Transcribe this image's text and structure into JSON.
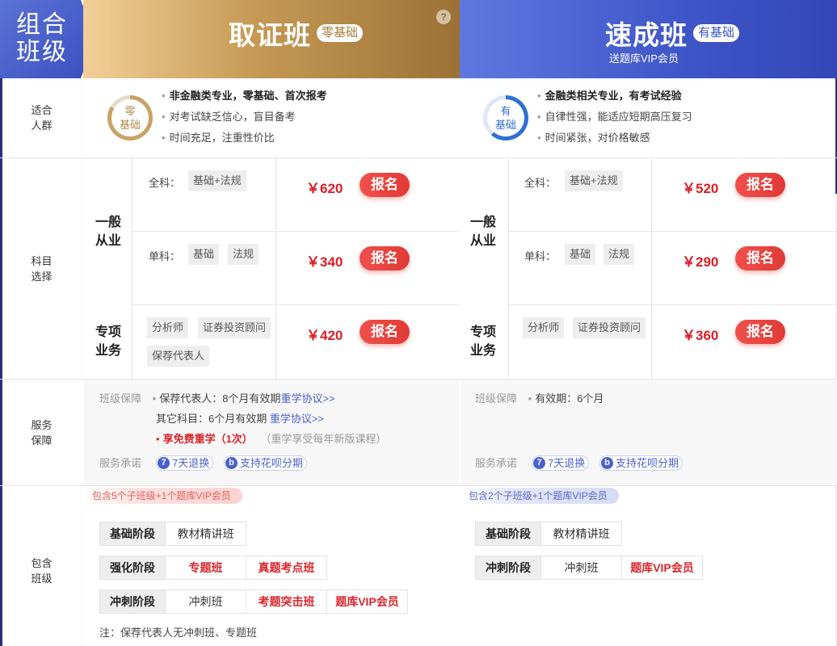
{
  "corner_label": "组合班级",
  "plans": [
    {
      "title": "取证班",
      "tag": "零基础",
      "subtitle": "",
      "help_icon": "?",
      "ring_label": "零基础",
      "ring_color": "#c9a266",
      "audience": [
        {
          "text": "非金融类专业，零基础、首次报考",
          "bold": true
        },
        {
          "text": "对考试缺乏信心，盲目备考",
          "bold": false
        },
        {
          "text": "时间充足，注重性价比",
          "bold": false
        }
      ],
      "general_group": "一般从业",
      "special_group": "专项业务",
      "rows": [
        {
          "label": "全科：",
          "subjects": [
            "基础+法规"
          ],
          "price": "￥620",
          "button": "报名"
        },
        {
          "label": "单科：",
          "subjects": [
            "基础",
            "法规"
          ],
          "price": "￥340",
          "button": "报名"
        },
        {
          "label": "",
          "subjects": [
            "分析师",
            "证券投资顾问",
            "保荐代表人"
          ],
          "price": "￥420",
          "button": "报名"
        }
      ],
      "service": {
        "guarantee_label": "班级保障",
        "lines": [
          {
            "prefix": "保荐代表人：8个月有效期",
            "link": "重学协议>>"
          },
          {
            "prefix": "其它科目：6个月有效期 ",
            "link": "重学协议>>"
          }
        ],
        "highlight": "享免费重学（1次）",
        "highlight_note": "（重学享受每年新版课程）",
        "promise_label": "服务承诺",
        "badges": [
          {
            "icon": "7",
            "text": "7天退换"
          },
          {
            "icon": "b",
            "text": "支持花呗分期"
          }
        ]
      },
      "includes_bar": "包含5个子班级+1个题库VIP会员",
      "stages": [
        {
          "stage": "基础阶段",
          "classes": [
            {
              "name": "教材精讲班",
              "red": false
            }
          ]
        },
        {
          "stage": "强化阶段",
          "classes": [
            {
              "name": "专题班",
              "red": true
            },
            {
              "name": "真题考点班",
              "red": true
            }
          ]
        },
        {
          "stage": "冲刺阶段",
          "classes": [
            {
              "name": "冲刺班",
              "red": false
            },
            {
              "name": "考题突击班",
              "red": true
            },
            {
              "name": "题库VIP会员",
              "red": true
            }
          ]
        }
      ],
      "note": "注：保荐代表人无冲刺班、专题班"
    },
    {
      "title": "速成班",
      "tag": "有基础",
      "subtitle": "送题库VIP会员",
      "ring_label": "有基础",
      "ring_color": "#2f6fd6",
      "audience": [
        {
          "text": "金融类相关专业，有考试经验",
          "bold": true
        },
        {
          "text": "自律性强，能适应短期高压复习",
          "bold": false
        },
        {
          "text": "时间紧张，对价格敏感",
          "bold": false
        }
      ],
      "general_group": "一般从业",
      "special_group": "专项业务",
      "rows": [
        {
          "label": "全科：",
          "subjects": [
            "基础+法规"
          ],
          "price": "￥520",
          "button": "报名"
        },
        {
          "label": "单科：",
          "subjects": [
            "基础",
            "法规"
          ],
          "price": "￥290",
          "button": "报名"
        },
        {
          "label": "",
          "subjects": [
            "分析师",
            "证券投资顾问"
          ],
          "price": "￥360",
          "button": "报名"
        }
      ],
      "service": {
        "guarantee_label": "班级保障",
        "lines": [
          {
            "prefix": "有效期：6个月",
            "link": ""
          }
        ],
        "promise_label": "服务承诺",
        "badges": [
          {
            "icon": "7",
            "text": "7天退换"
          },
          {
            "icon": "b",
            "text": "支持花呗分期"
          }
        ]
      },
      "includes_bar": "包含2个子班级+1个题库VIP会员",
      "stages": [
        {
          "stage": "基础阶段",
          "classes": [
            {
              "name": "教材精讲班",
              "red": false
            }
          ]
        },
        {
          "stage": "冲刺阶段",
          "classes": [
            {
              "name": "冲刺班",
              "red": false
            },
            {
              "name": "题库VIP会员",
              "red": true
            }
          ]
        }
      ]
    }
  ],
  "row_labels": {
    "audience": "适合人群",
    "subjects": "科目选择",
    "service": "服务保障",
    "includes": "包含班级"
  },
  "colors": {
    "gold": "#c69a55",
    "blue": "#3e55c8",
    "price_red": "#e01c24",
    "button_red": "#e8433f",
    "link_blue": "#4a5fcf"
  }
}
